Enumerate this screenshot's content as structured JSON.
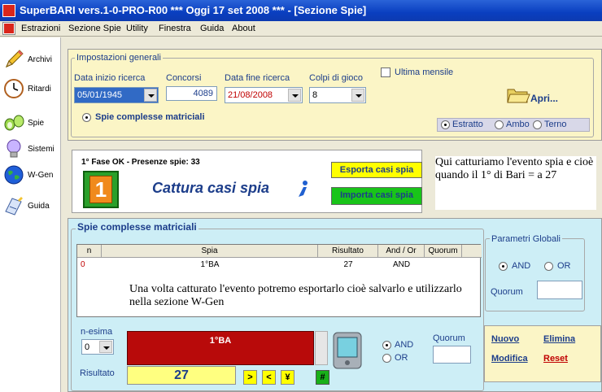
{
  "window": {
    "title": "SuperBARI vers.1-0-PRO-R00   ***  Oggi 17 set 2008  ***   - [Sezione Spie]"
  },
  "menu": {
    "items": [
      "Estrazioni",
      "Sezione Spie",
      "Utility",
      "Finestra",
      "Guida",
      "About"
    ]
  },
  "sidebar": {
    "items": [
      {
        "label": "Archivi",
        "icon": "pencil-icon"
      },
      {
        "label": "Ritardi",
        "icon": "clock-icon"
      },
      {
        "label": "Spie",
        "icon": "binoculars-icon"
      },
      {
        "label": "Sistemi",
        "icon": "lightbulb-icon"
      },
      {
        "label": "W-Gen",
        "icon": "globe-icon"
      },
      {
        "label": "Guida",
        "icon": "book-icon"
      }
    ]
  },
  "settings": {
    "legend": "Impostazioni generali",
    "data_inizio_label": "Data inizio ricerca",
    "data_inizio_value": "05/01/1945",
    "concorsi_label": "Concorsi",
    "concorsi_value": "4089",
    "data_fine_label": "Data fine ricerca",
    "data_fine_value": "21/08/2008",
    "colpi_label": "Colpi di gioco",
    "colpi_value": "8",
    "ultima_mensile_label": "Ultima mensile",
    "apri_label": "Apri...",
    "spie_matriciali_label": "Spie complesse matriciali",
    "sorte_options": [
      "Estratto",
      "Ambo",
      "Terno"
    ],
    "sorte_selected": "Estratto"
  },
  "capture": {
    "status": "1° Fase OK - Presenze spie: 33",
    "title": "Cattura casi spia",
    "badge_number": "1",
    "esporta_label": "Esporta casi spia",
    "importa_label": "Importa casi spia",
    "note": "Qui catturiamo l'evento spia e cioè quando il 1° di Bari = a 27"
  },
  "matrix": {
    "legend": "Spie complesse matriciali",
    "columns": [
      "n",
      "Spia",
      "Risultato",
      "And / Or",
      "Quorum"
    ],
    "rows": [
      {
        "n": "0",
        "spia": "1°BA",
        "risultato": "27",
        "andor": "AND",
        "quorum": ""
      }
    ],
    "note": "Una volta catturato l'evento potremo esportarlo cioè salvarlo e utilizzarlo nella sezione W-Gen",
    "nesima_label": "n-esima",
    "nesima_value": "0",
    "spia_display": "1°BA",
    "risultato_label": "Risultato",
    "risultato_value": "27",
    "nav_buttons": [
      ">",
      "<",
      "¥"
    ],
    "hash_button": "#",
    "logic_options": [
      "AND",
      "OR"
    ],
    "logic_selected": "AND",
    "quorum_label": "Quorum",
    "actions": {
      "nuovo": "Nuovo",
      "elimina": "Elimina",
      "modifica": "Modifica",
      "reset": "Reset"
    }
  },
  "global_params": {
    "legend": "Parametri Globali",
    "options": [
      "AND",
      "OR"
    ],
    "selected": "AND",
    "quorum_label": "Quorum"
  }
}
